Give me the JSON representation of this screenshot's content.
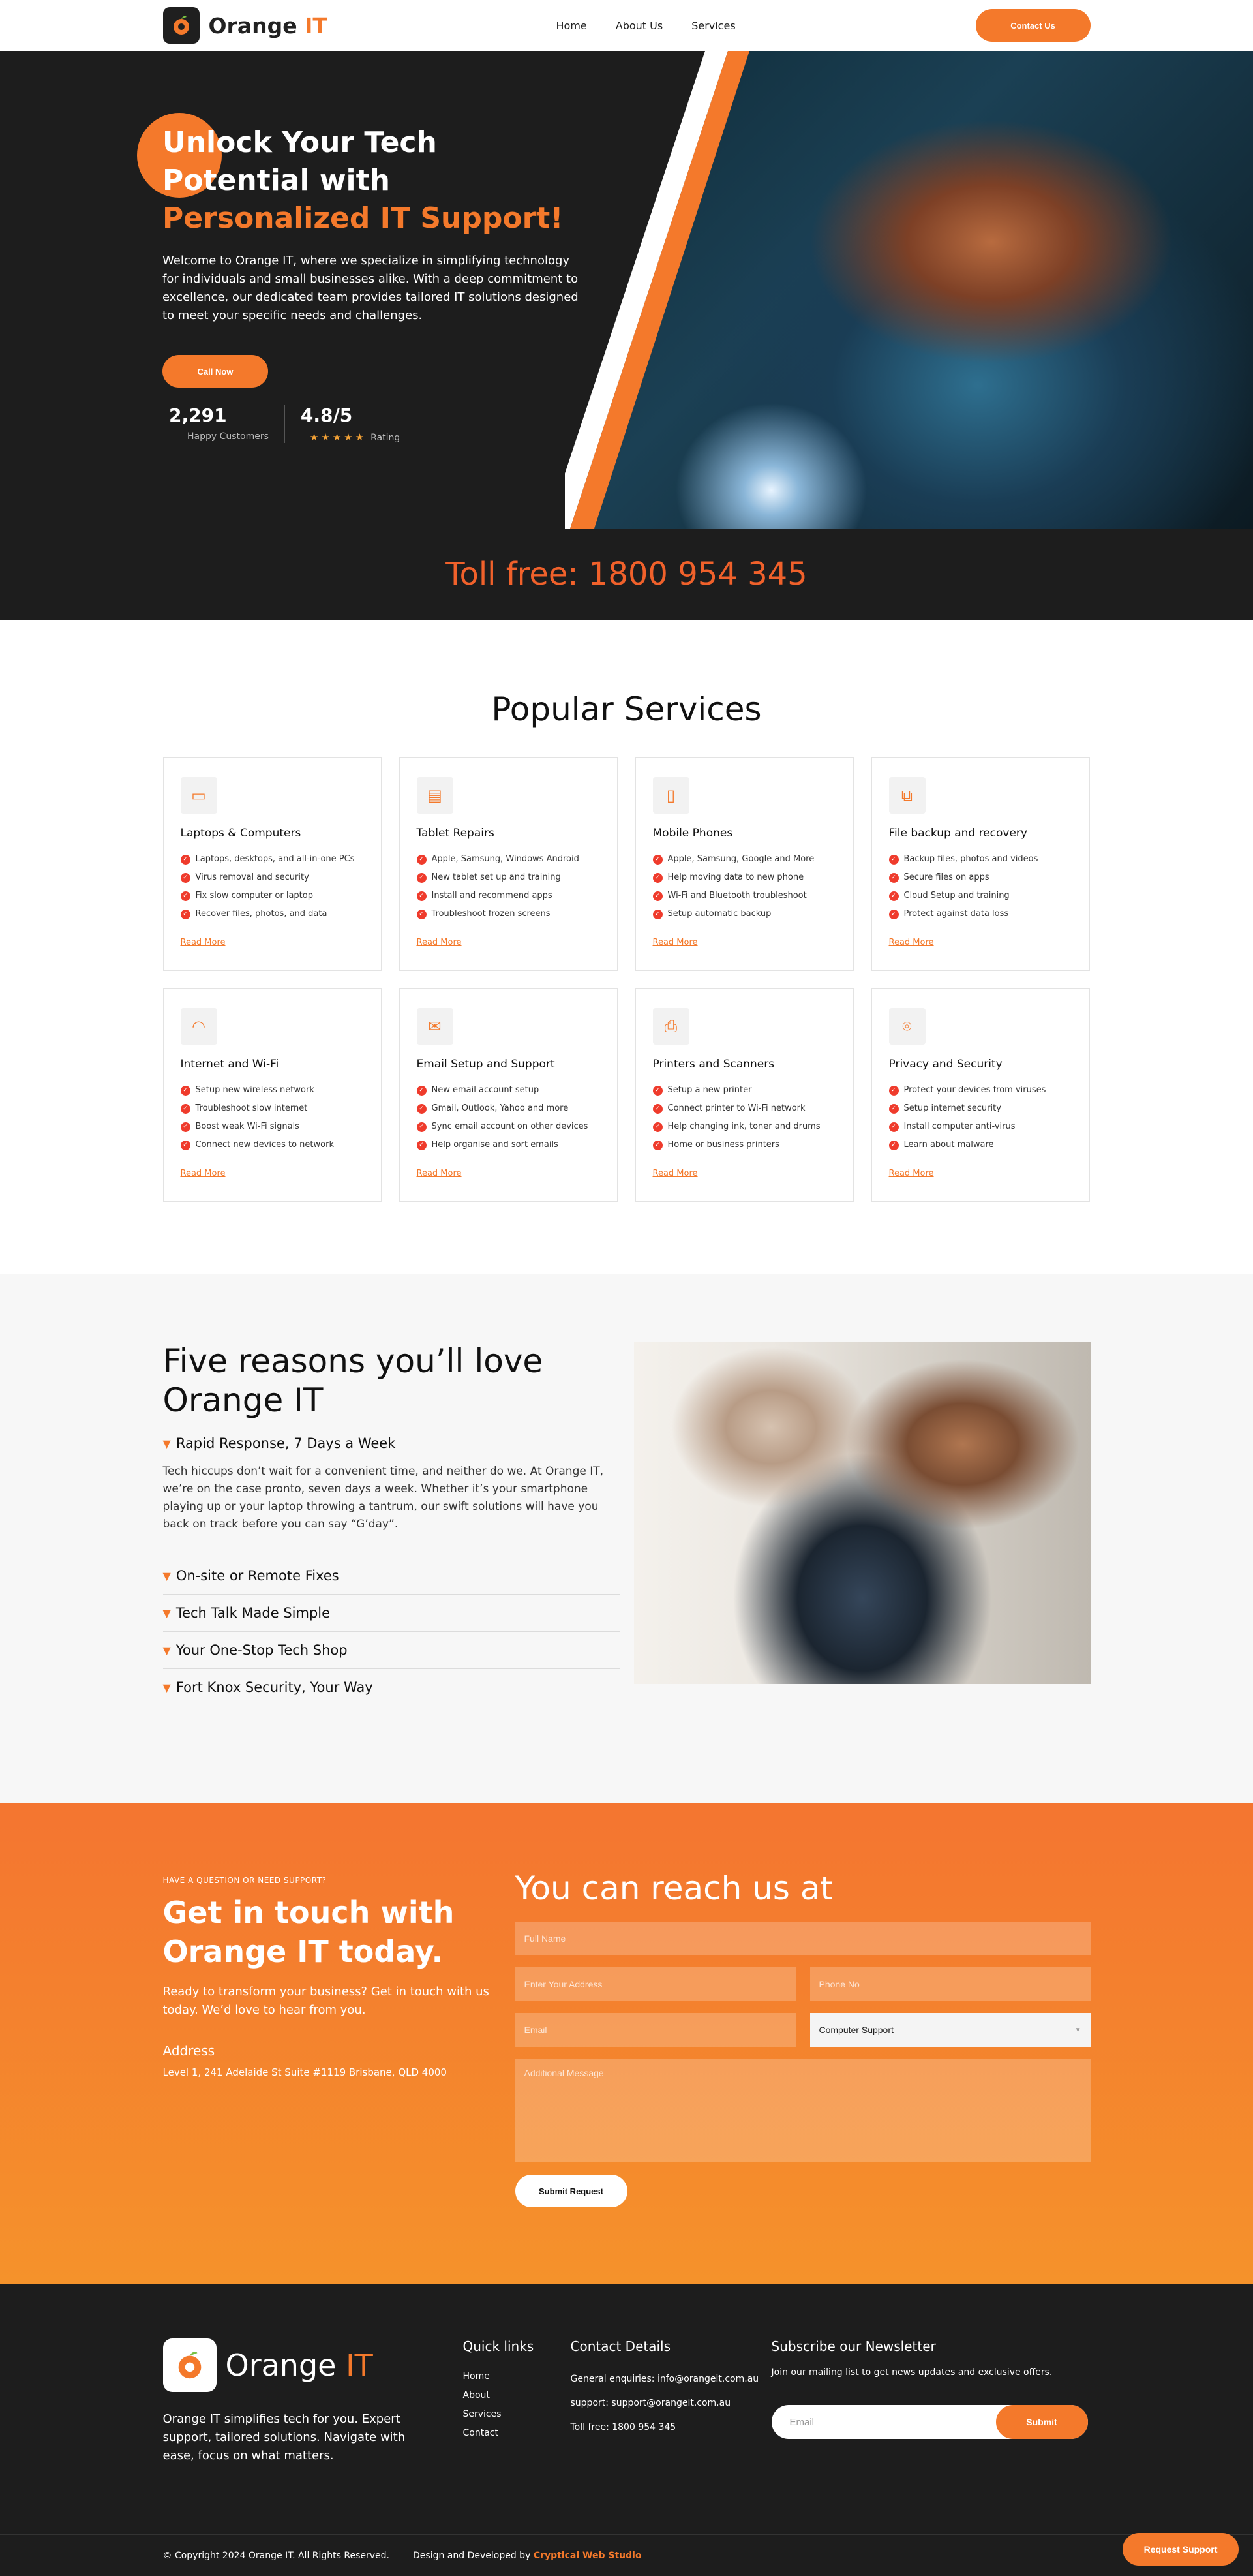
{
  "brand": {
    "name_a": "Orange",
    "name_b": "IT",
    "accent": "#f4792b",
    "dark": "#1d1d1d"
  },
  "nav": {
    "items": [
      "Home",
      "About Us",
      "Services"
    ],
    "contact_label": "Contact Us"
  },
  "hero": {
    "title_a": "Unlock Your Tech Potential with",
    "title_b": "Personalized IT Support!",
    "intro": "Welcome to Orange IT, where we specialize in simplifying technology for individuals and small businesses alike. With a deep commitment to excellence, our dedicated team provides tailored IT solutions designed to meet your specific needs and challenges.",
    "cta": "Call Now",
    "stats": [
      {
        "value": "2,291",
        "label": "Happy Customers"
      },
      {
        "value": "4.8/5",
        "label": "Rating",
        "stars": "★★★★★"
      }
    ]
  },
  "toll": "Toll free: 1800 954 345",
  "services": {
    "title": "Popular Services",
    "read_more": "Read More",
    "cards": [
      {
        "icon": "laptop-icon",
        "glyph": "▭",
        "title": "Laptops & Computers",
        "items": [
          "Laptops, desktops, and all-in-one PCs",
          "Virus removal and security",
          "Fix slow computer or laptop",
          "Recover files, photos, and data"
        ]
      },
      {
        "icon": "tablet-icon",
        "glyph": "▤",
        "title": "Tablet Repairs",
        "items": [
          "Apple, Samsung, Windows Android",
          "New tablet set up and training",
          "Install and recommend apps",
          "Troubleshoot frozen screens"
        ]
      },
      {
        "icon": "phone-icon",
        "glyph": "▯",
        "title": "Mobile Phones",
        "items": [
          "Apple, Samsung, Google and More",
          "Help moving data to new phone",
          "Wi-Fi and Bluetooth troubleshoot",
          "Setup automatic backup"
        ]
      },
      {
        "icon": "backup-icon",
        "glyph": "⧉",
        "title": "File backup and recovery",
        "items": [
          "Backup files, photos and videos",
          "Secure files on apps",
          "Cloud Setup and training",
          "Protect against data loss"
        ]
      },
      {
        "icon": "wifi-icon",
        "glyph": "◠",
        "title": "Internet and Wi-Fi",
        "items": [
          "Setup new wireless network",
          "Troubleshoot slow internet",
          "Boost weak Wi-Fi signals",
          "Connect new devices to network"
        ]
      },
      {
        "icon": "email-icon",
        "glyph": "✉",
        "title": "Email Setup and Support",
        "items": [
          "New email account setup",
          "Gmail, Outlook, Yahoo and more",
          "Sync email account on other devices",
          "Help organise and sort emails"
        ]
      },
      {
        "icon": "printer-icon",
        "glyph": "⎙",
        "title": "Printers and Scanners",
        "items": [
          "Setup a new printer",
          "Connect printer to Wi-Fi network",
          "Help changing ink, toner and drums",
          "Home or business printers"
        ]
      },
      {
        "icon": "security-icon",
        "glyph": "⌾",
        "title": "Privacy and Security",
        "items": [
          "Protect your devices from viruses",
          "Setup internet security",
          "Install computer anti-virus",
          "Learn about malware"
        ]
      }
    ]
  },
  "reasons": {
    "title": "Five reasons you’ll love Orange IT",
    "items": [
      {
        "title": "Rapid Response, 7 Days a Week",
        "body": "Tech hiccups don’t wait for a convenient time, and neither do we. At Orange IT, we’re on the case pronto, seven days a week. Whether it’s your smartphone playing up or your laptop throwing a tantrum, our swift solutions will have you back on track before you can say “G’day”."
      },
      {
        "title": "On-site or Remote Fixes"
      },
      {
        "title": "Tech Talk Made Simple"
      },
      {
        "title": "Your One-Stop Tech Shop"
      },
      {
        "title": "Fort Knox Security, Your Way"
      }
    ]
  },
  "contact": {
    "kicker": "HAVE A QUESTION OR NEED SUPPORT?",
    "title": "Get in touch with Orange IT today.",
    "body": "Ready to transform your business? Get in touch with us today. We’d love to hear from you.",
    "address_heading": "Address",
    "address": "Level 1, 241 Adelaide St Suite #1119 Brisbane, QLD 4000",
    "form_title": "You can reach us at",
    "placeholders": {
      "name": "Full Name",
      "address": "Enter Your Address",
      "phone": "Phone No",
      "email": "Email",
      "message": "Additional Message"
    },
    "service_selected": "Computer Support",
    "submit": "Submit Request"
  },
  "footer": {
    "about": "Orange IT simplifies tech for you. Expert support, tailored solutions. Navigate with ease, focus on what matters.",
    "quick_links_title": "Quick links",
    "quick_links": [
      "Home",
      "About",
      "Services",
      "Contact"
    ],
    "details_title": "Contact Details",
    "details": [
      "General enquiries: info@orangeit.com.au",
      "support: support@orangeit.com.au",
      "Toll free: 1800 954 345"
    ],
    "newsletter_title": "Subscribe our Newsletter",
    "newsletter_text": "Join our mailing list to get news updates and exclusive offers.",
    "email_placeholder": "Email",
    "subscribe": "Submit",
    "copyright": "© Copyright 2024 Orange IT. All Rights Reserved.",
    "credit_a": "Design and Developed by",
    "credit_b": "Cryptical Web Studio",
    "float_button": "Request Support"
  }
}
